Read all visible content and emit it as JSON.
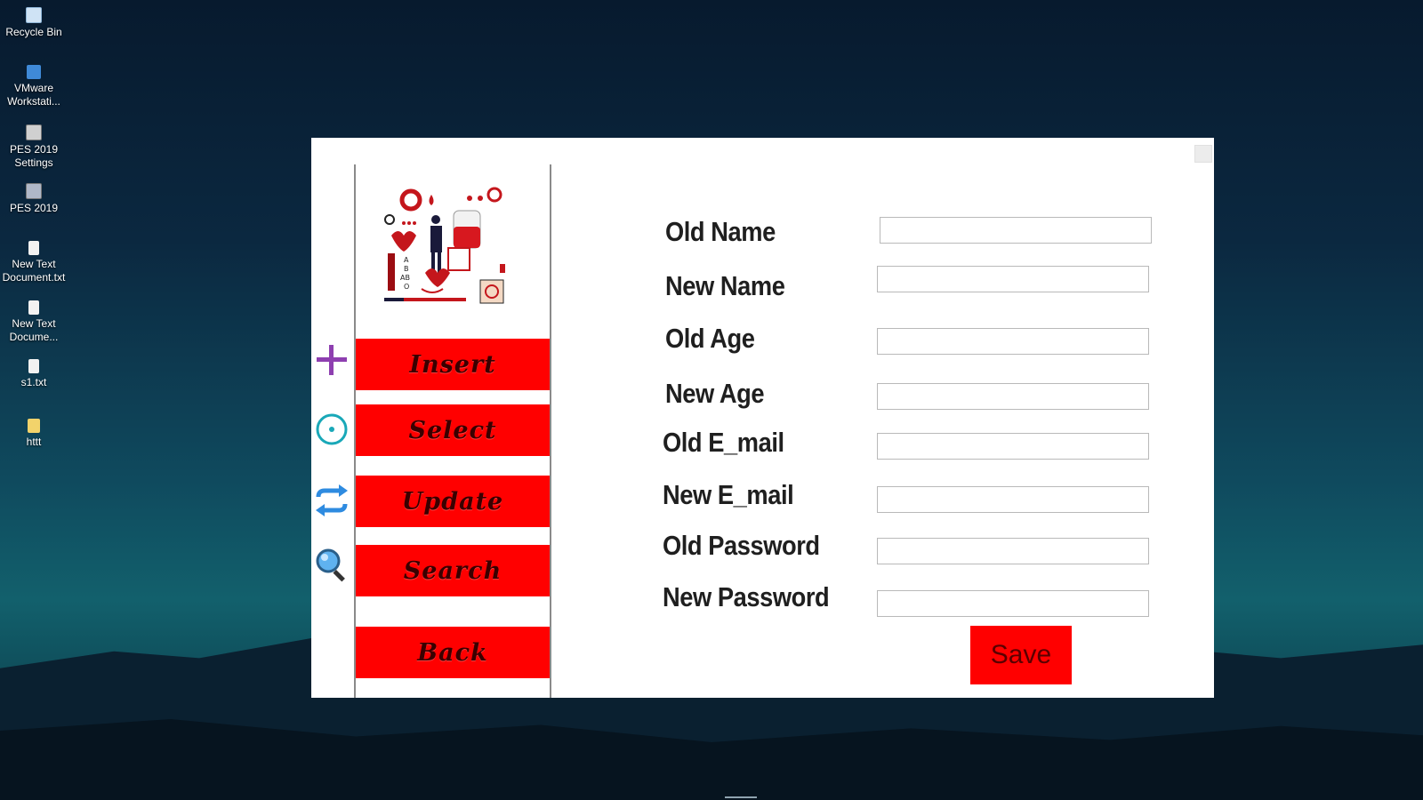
{
  "desktop": {
    "icons": [
      {
        "name": "recycle-bin",
        "label": "Recycle Bin",
        "color": "#cfe3f5"
      },
      {
        "name": "vmware",
        "label": "VMware Workstati...",
        "color": "#3f8ad8"
      },
      {
        "name": "pes-settings",
        "label": "PES 2019 Settings",
        "color": "#d0d0d0"
      },
      {
        "name": "pes",
        "label": "PES 2019",
        "color": "#b0b8c8"
      },
      {
        "name": "text-doc-1",
        "label": "New Text Document.txt",
        "color": "#f2f2f2"
      },
      {
        "name": "text-doc-2",
        "label": "New Text Docume...",
        "color": "#f2f2f2"
      },
      {
        "name": "s1-txt",
        "label": "s1.txt",
        "color": "#f2f2f2"
      },
      {
        "name": "httt-folder",
        "label": "httt",
        "color": "#f2d36b"
      }
    ]
  },
  "sidebar": {
    "icons": [
      "plus-icon",
      "target-icon",
      "refresh-icon",
      "magnifier-icon"
    ],
    "buttons": {
      "insert": "Insert",
      "select": "Select",
      "update": "Update",
      "search": "Search",
      "back": "Back"
    }
  },
  "form": {
    "old_name_label": "Old Name",
    "new_name_label": "New Name",
    "old_age_label": "Old Age",
    "new_age_label": "New Age",
    "old_email_label": "Old E_mail",
    "new_email_label": "New E_mail",
    "old_password_label": "Old Password",
    "new_password_label": "New Password",
    "save_label": "Save"
  },
  "colors": {
    "accent": "#ff0000",
    "plus": "#8e3fb0",
    "target": "#19a8b8",
    "refresh": "#2e8be0"
  }
}
